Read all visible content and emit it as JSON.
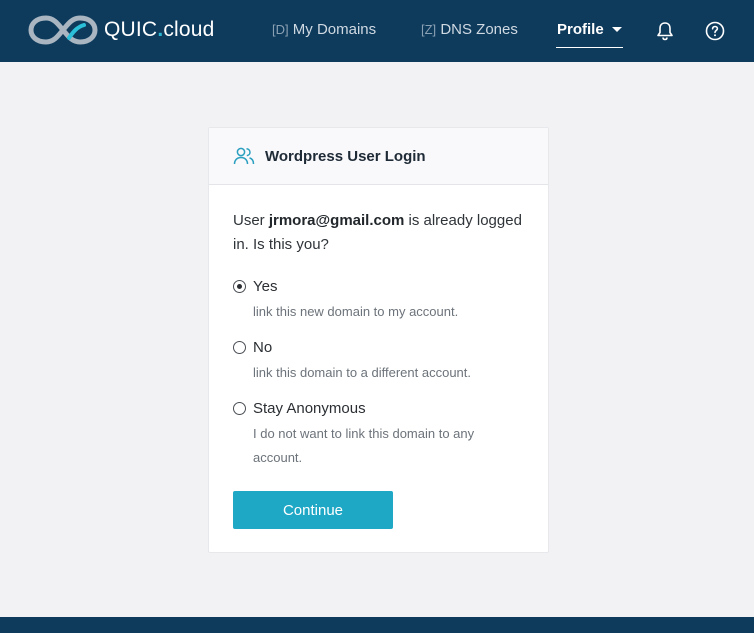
{
  "header": {
    "brand_main": "QUIC",
    "brand_dot": ".",
    "brand_suffix": "cloud",
    "nav": {
      "domains_key": "[D]",
      "domains_label": "My Domains",
      "dns_key": "[Z]",
      "dns_label": "DNS Zones",
      "profile_label": "Profile"
    },
    "icons": [
      "bell-icon",
      "help-icon",
      "chevron-down-icon"
    ]
  },
  "card": {
    "title": "Wordpress User Login",
    "intro_prefix": "User ",
    "intro_email": "jrmora@gmail.com",
    "intro_suffix": " is already logged in. Is this you?",
    "options": [
      {
        "label": "Yes",
        "description": "link this new domain to my account.",
        "checked": true
      },
      {
        "label": "No",
        "description": "link this domain to a different account.",
        "checked": false
      },
      {
        "label": "Stay Anonymous",
        "description": "I do not want to link this domain to any account.",
        "checked": false
      }
    ],
    "continue_label": "Continue"
  },
  "colors": {
    "navbar": "#0e3a5c",
    "accent": "#1fa8c6",
    "page_bg": "#f2f2f4"
  }
}
